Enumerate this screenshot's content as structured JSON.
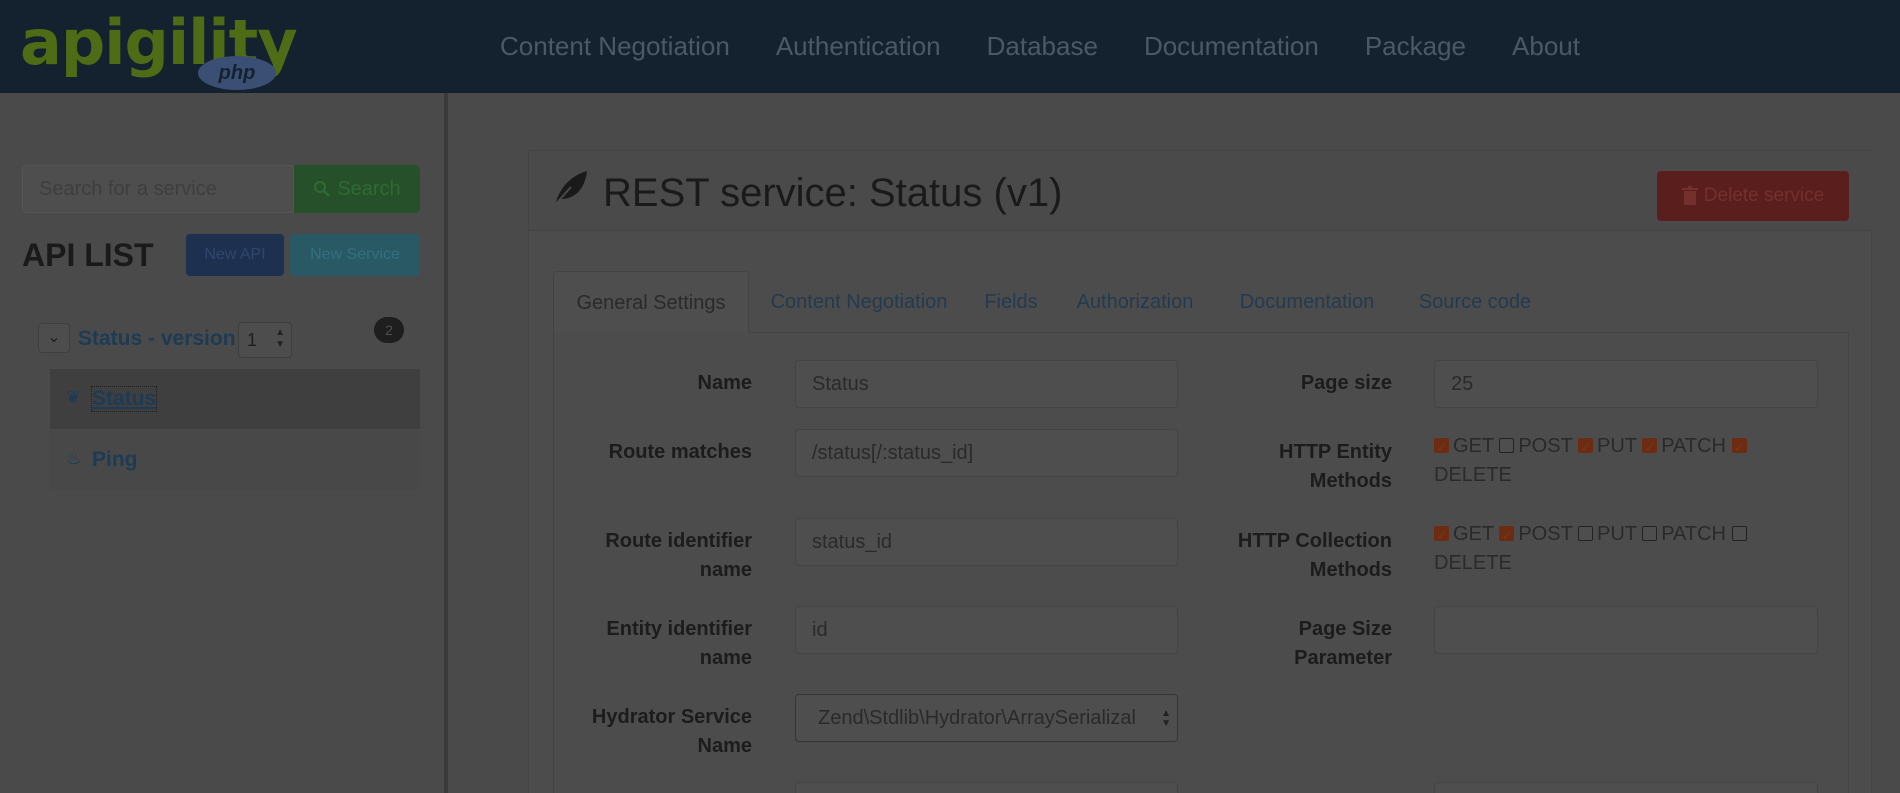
{
  "brand": {
    "logo_text": "apigility",
    "logo_sub": "php"
  },
  "nav": [
    {
      "label": "Content Negotiation"
    },
    {
      "label": "Authentication"
    },
    {
      "label": "Database"
    },
    {
      "label": "Documentation"
    },
    {
      "label": "Package"
    },
    {
      "label": "About"
    }
  ],
  "sidebar": {
    "search_placeholder": "Search for a service",
    "search_button": "Search",
    "title": "API LIST",
    "new_api": "New API",
    "new_service": "New Service",
    "api": {
      "name": "Status - version",
      "version": "1",
      "service_count": "2"
    },
    "services": [
      {
        "label": "Status",
        "icon": "leaf-icon",
        "active": true
      },
      {
        "label": "Ping",
        "icon": "fire-icon",
        "active": false
      }
    ]
  },
  "panel": {
    "title": "REST service: Status (v1)",
    "delete_button": "Delete service",
    "tabs": [
      {
        "label": "General Settings",
        "active": true
      },
      {
        "label": "Content Negotiation"
      },
      {
        "label": "Fields"
      },
      {
        "label": "Authorization"
      },
      {
        "label": "Documentation"
      },
      {
        "label": "Source code"
      }
    ],
    "form": {
      "name_label": "Name",
      "name_value": "Status",
      "route_label": "Route matches",
      "route_value": "/status[/:status_id]",
      "route_id_label_1": "Route identifier",
      "route_id_label_2": "name",
      "route_id_value": "status_id",
      "entity_id_label_1": "Entity identifier",
      "entity_id_label_2": "name",
      "entity_id_value": "id",
      "hydrator_label_1": "Hydrator Service",
      "hydrator_label_2": "Name",
      "hydrator_value": "Zend\\Stdlib\\Hydrator\\ArraySerializal",
      "page_size_label": "Page size",
      "page_size_value": "25",
      "entity_methods_label_1": "HTTP Entity",
      "entity_methods_label_2": "Methods",
      "entity_methods": [
        {
          "label": "GET",
          "checked": true
        },
        {
          "label": "POST",
          "checked": false
        },
        {
          "label": "PUT",
          "checked": true
        },
        {
          "label": "PATCH",
          "checked": true
        },
        {
          "label": "DELETE",
          "checked": true
        }
      ],
      "collection_methods_label_1": "HTTP Collection",
      "collection_methods_label_2": "Methods",
      "collection_methods": [
        {
          "label": "GET",
          "checked": true
        },
        {
          "label": "POST",
          "checked": true
        },
        {
          "label": "PUT",
          "checked": false
        },
        {
          "label": "PATCH",
          "checked": false
        },
        {
          "label": "DELETE",
          "checked": false
        }
      ],
      "page_size_param_label_1": "Page Size",
      "page_size_param_label_2": "Parameter",
      "page_size_param_value": ""
    }
  },
  "colors": {
    "overlay_bg": "#4a4a4a",
    "topbar": "#14222f",
    "link": "#1d3b55",
    "checkbox_checked": "#6b2c12"
  }
}
